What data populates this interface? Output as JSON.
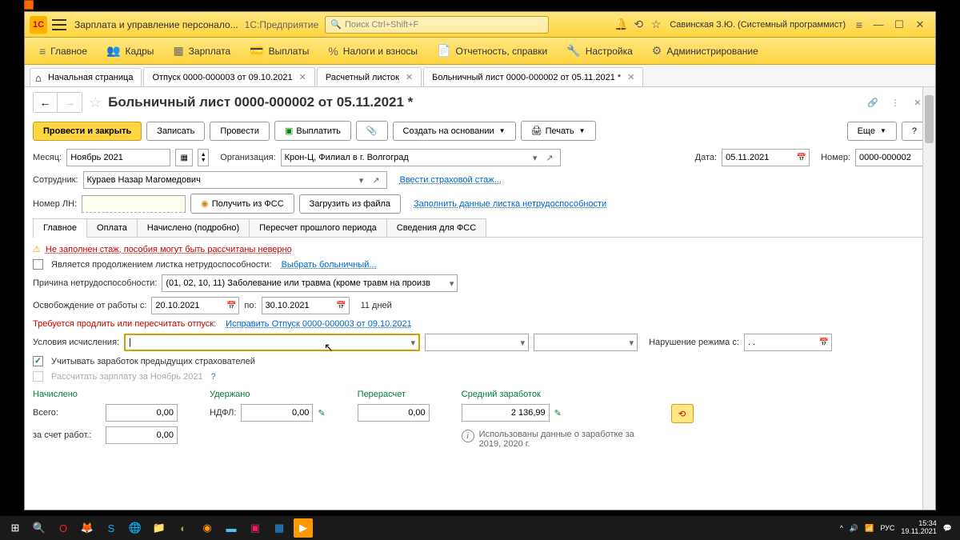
{
  "titlebar": {
    "logo": "1C",
    "title": "Зарплата и управление персонало...",
    "subtitle": "1С:Предприятие",
    "search_placeholder": "Поиск Ctrl+Shift+F",
    "user": "Савинская З.Ю. (Системный программист)"
  },
  "menubar": [
    {
      "label": "Главное"
    },
    {
      "label": "Кадры"
    },
    {
      "label": "Зарплата"
    },
    {
      "label": "Выплаты"
    },
    {
      "label": "Налоги и взносы"
    },
    {
      "label": "Отчетность, справки"
    },
    {
      "label": "Настройка"
    },
    {
      "label": "Администрирование"
    }
  ],
  "tabs": [
    {
      "label": "Начальная страница",
      "closable": false,
      "home": true
    },
    {
      "label": "Отпуск 0000-000003 от 09.10.2021",
      "closable": true
    },
    {
      "label": "Расчетный листок",
      "closable": true
    },
    {
      "label": "Больничный лист 0000-000002 от 05.11.2021 *",
      "closable": true,
      "active": true
    }
  ],
  "page": {
    "title": "Больничный лист 0000-000002 от 05.11.2021 *",
    "toolbar": {
      "post_close": "Провести и закрыть",
      "save": "Записать",
      "post": "Провести",
      "pay": "Выплатить",
      "create_based": "Создать на основании",
      "print": "Печать",
      "more": "Еще",
      "help": "?"
    },
    "fields": {
      "month_lbl": "Месяц:",
      "month": "Ноябрь 2021",
      "org_lbl": "Организация:",
      "org": "Крон-Ц, Филиал в г. Волгоград",
      "date_lbl": "Дата:",
      "date": "05.11.2021",
      "num_lbl": "Номер:",
      "num": "0000-000002",
      "emp_lbl": "Сотрудник:",
      "emp": "Кураев Назар Магомедович",
      "ins_link": "Ввести страховой стаж...",
      "ln_lbl": "Номер ЛН:",
      "get_fss": "Получить из ФСС",
      "load_file": "Загрузить из файла",
      "fill_link": "Заполнить данные листка нетрудоспособности"
    },
    "tabs2": [
      "Главное",
      "Оплата",
      "Начислено (подробно)",
      "Пересчет прошлого периода",
      "Сведения для ФСС"
    ],
    "warning": "Не заполнен стаж, пособия могут быть рассчитаны неверно",
    "continuation_lbl": "Является продолжением листка нетрудоспособности:",
    "select_sick": "Выбрать больничный...",
    "reason_lbl": "Причина нетрудоспособности:",
    "reason": "(01, 02, 10, 11) Заболевание или травма (кроме травм на произв",
    "release_lbl": "Освобождение от работы с:",
    "release_from": "20.10.2021",
    "to_lbl": "по:",
    "release_to": "30.10.2021",
    "days": "11 дней",
    "need_fix": "Требуется продлить или пересчитать отпуск:",
    "fix_link": "Исправить Отпуск 0000-000003 от 09.10.2021",
    "cond_lbl": "Условия исчисления:",
    "violation_lbl": "Нарушение режима с:",
    "violation_val": " .  .",
    "prev_ins": "Учитывать заработок предыдущих страхователей",
    "calc_salary": "Рассчитать зарплату за Ноябрь 2021",
    "summary": {
      "accrued": "Начислено",
      "total_lbl": "Всего:",
      "total": "0,00",
      "employer_lbl": "за счет работ.:",
      "employer": "0,00",
      "withheld": "Удержано",
      "ndfl_lbl": "НДФЛ:",
      "ndfl": "0,00",
      "recalc": "Перерасчет",
      "recalc_val": "0,00",
      "avg": "Средний заработок",
      "avg_val": "2 136,99",
      "info": "Использованы данные о заработке за 2019,  2020 г."
    }
  },
  "taskbar": {
    "time": "15:34",
    "date": "19.11.2021",
    "lang": "РУС"
  }
}
